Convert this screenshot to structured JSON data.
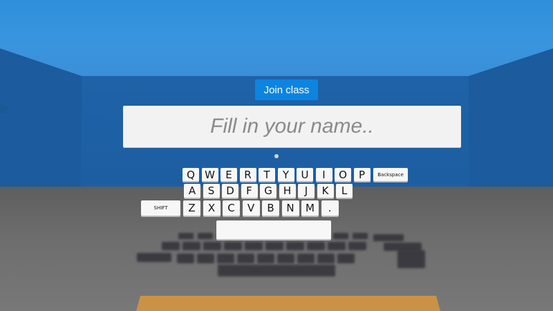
{
  "scene": {
    "side_text": "le"
  },
  "join_button": {
    "label": "Join class"
  },
  "name_field": {
    "placeholder": "Fill in your name.."
  },
  "keyboard": {
    "row1": [
      "Q",
      "W",
      "E",
      "R",
      "T",
      "Y",
      "U",
      "I",
      "O",
      "P"
    ],
    "backspace": "Backspace",
    "row2": [
      "A",
      "S",
      "D",
      "F",
      "G",
      "H",
      "J",
      "K",
      "L"
    ],
    "shift": "SHIFT",
    "row3": [
      "Z",
      "X",
      "C",
      "V",
      "B",
      "N",
      "M",
      "."
    ],
    "space": ""
  },
  "colors": {
    "sky": "#3a95de",
    "wall": "#1f62a7",
    "floor": "#6d6d6d",
    "button": "#0d84e0",
    "table": "#c99247"
  }
}
